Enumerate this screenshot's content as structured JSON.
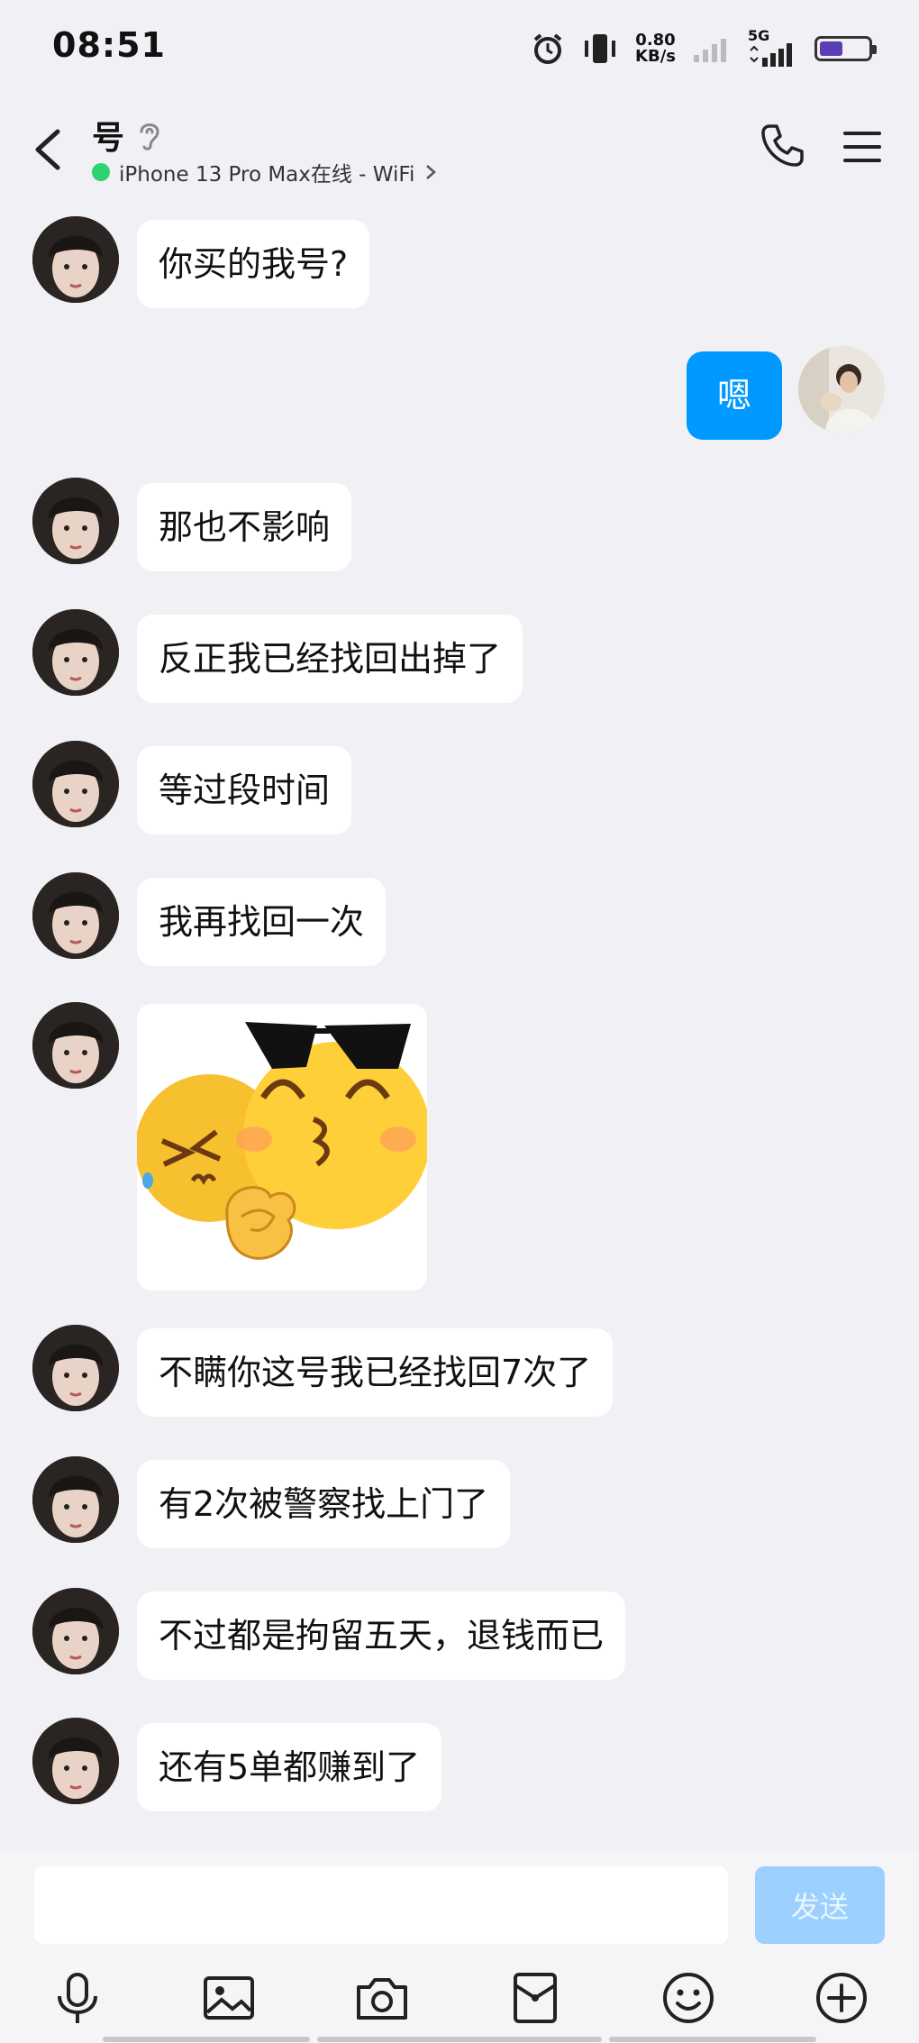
{
  "status_bar": {
    "time": "08:51",
    "net_speed_value": "0.80",
    "net_speed_unit": "KB/s",
    "network": "5G",
    "battery_level": 0.48
  },
  "header": {
    "name": "号",
    "status": "iPhone 13 Pro Max在线 - WiFi",
    "status_color": "#2dd36f"
  },
  "messages": [
    {
      "from": "them",
      "text": "你买的我号?"
    },
    {
      "from": "me",
      "text": "嗯"
    },
    {
      "from": "them",
      "text": "那也不影响"
    },
    {
      "from": "them",
      "text": "反正我已经找回出掉了"
    },
    {
      "from": "them",
      "text": "等过段时间"
    },
    {
      "from": "them",
      "text": "我再找回一次"
    },
    {
      "from": "them",
      "type": "sticker"
    },
    {
      "from": "them",
      "text": "不瞒你这号我已经找回7次了"
    },
    {
      "from": "them",
      "text": "有2次被警察找上门了"
    },
    {
      "from": "them",
      "text": "不过都是拘留五天，退钱而已"
    },
    {
      "from": "them",
      "text": "还有5单都赚到了"
    }
  ],
  "input": {
    "value": "",
    "send_label": "发送"
  },
  "colors": {
    "my_bubble": "#0099ff",
    "their_bubble": "#ffffff",
    "background": "#f0f0f5",
    "send_button": "#9bd0ff"
  },
  "toolbar_icons": [
    "microphone-icon",
    "image-icon",
    "camera-icon",
    "red-packet-icon",
    "emoji-icon",
    "plus-icon"
  ]
}
